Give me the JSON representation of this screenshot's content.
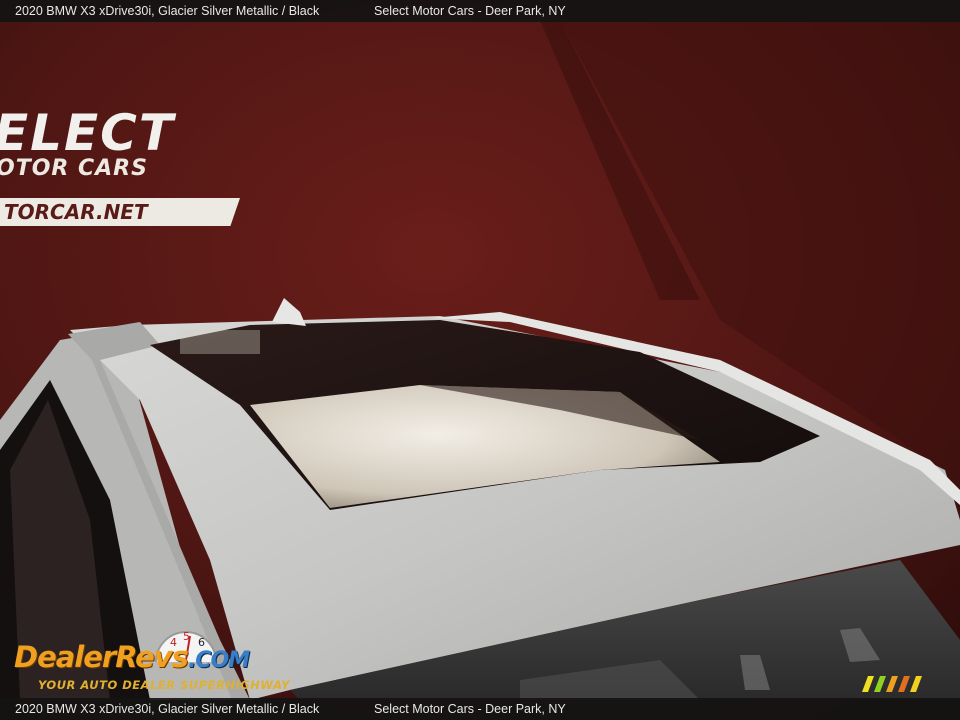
{
  "caption": {
    "vehicle": "2020 BMW X3 xDrive30i,   Glacier Silver Metallic / Black",
    "dealer": "Select Motor Cars - Deer Park, NY"
  },
  "wall_sign": {
    "line1": "ELECT",
    "line2": "OTOR CARS",
    "line3": "TORCAR.NET"
  },
  "watermark": {
    "brand": "DealerRevs",
    "domain": ".COM",
    "tagline": "YOUR AUTO DEALER SUPERHIGHWAY",
    "gauge_digits": "4 5 6"
  },
  "colors": {
    "wall": "#5a1a16",
    "car_paint": "#cfcfcf",
    "glass": "#1c1414",
    "caption_bg": "#141414",
    "watermark_orange": "#f0a020",
    "watermark_blue": "#3a7ec8"
  }
}
